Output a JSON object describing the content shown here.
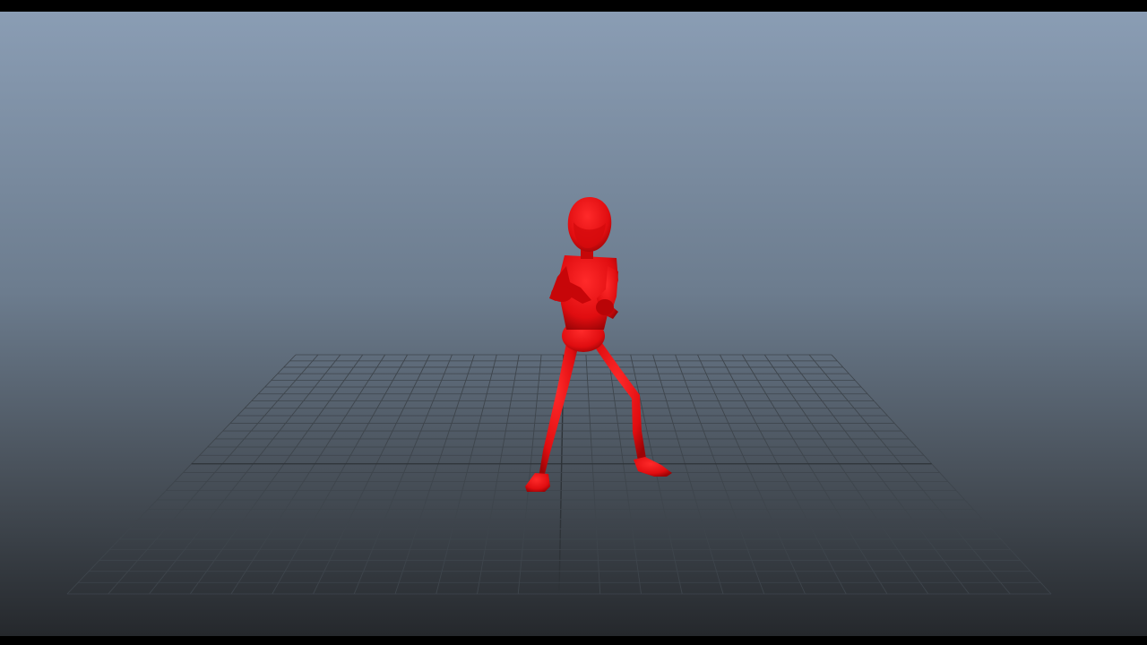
{
  "viewport": {
    "camera_label": "",
    "background_top_color": "#8a9db4",
    "background_bottom_color": "#25282c",
    "grid_color": "#3e454c",
    "grid_axis_color": "#2e3338"
  },
  "scene": {
    "character": {
      "icon": "humanoid-figure-icon",
      "color": "#e00d10",
      "shadow_color": "#9c0406"
    }
  }
}
